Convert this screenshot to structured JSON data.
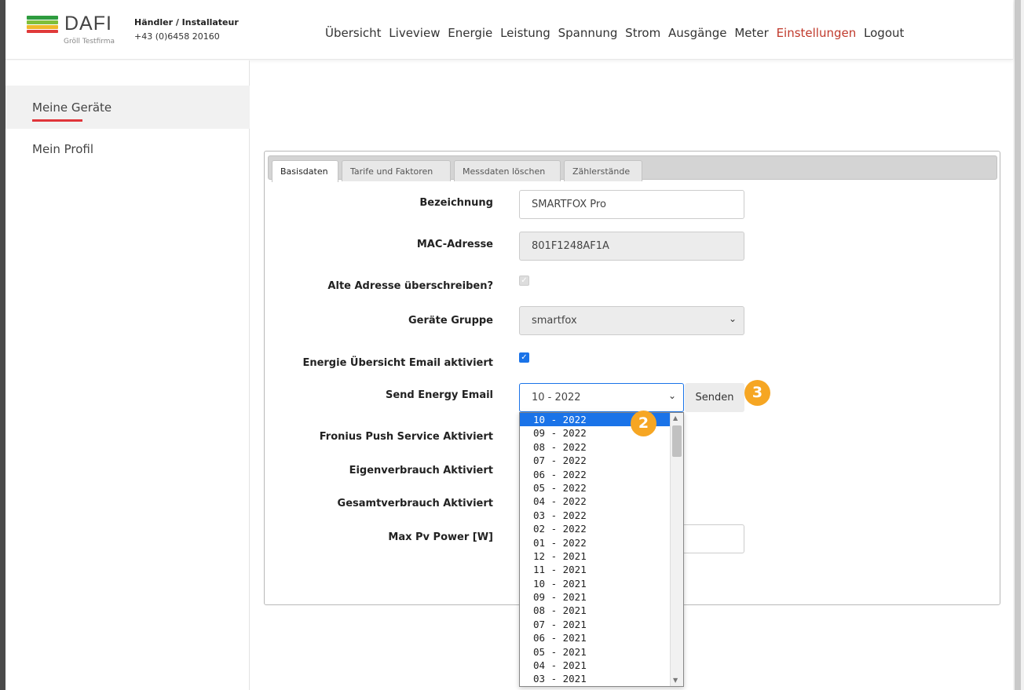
{
  "brand": {
    "name": "DAFI",
    "subtitle": "Gröll Testfirma",
    "logo_colors": [
      "#2e9c3f",
      "#7fbf3a",
      "#f0b92a",
      "#e03a3a"
    ]
  },
  "dealer": {
    "title": "Händler / Installateur",
    "phone": "+43 (0)6458 20160"
  },
  "nav": [
    "Übersicht",
    "Liveview",
    "Energie",
    "Leistung",
    "Spannung",
    "Strom",
    "Ausgänge",
    "Meter",
    "Einstellungen",
    "Logout"
  ],
  "nav_active": "Einstellungen",
  "sidebar": {
    "items": [
      {
        "label": "Meine Geräte",
        "active": true
      },
      {
        "label": "Mein Profil",
        "active": false
      }
    ]
  },
  "tabs": [
    {
      "label": "Basisdaten",
      "active": true
    },
    {
      "label": "Tarife und Faktoren",
      "active": false
    },
    {
      "label": "Messdaten löschen",
      "active": false
    },
    {
      "label": "Zählerstände",
      "active": false
    }
  ],
  "form": {
    "bezeichnung": {
      "label": "Bezeichnung",
      "value": "SMARTFOX Pro"
    },
    "mac": {
      "label": "MAC-Adresse",
      "value": "801F1248AF1A"
    },
    "alte_adresse": {
      "label": "Alte Adresse überschreiben?",
      "checked": true,
      "disabled": true
    },
    "gruppe": {
      "label": "Geräte Gruppe",
      "value": "smartfox"
    },
    "energie_email": {
      "label": "Energie Übersicht Email aktiviert",
      "checked": true
    },
    "send_energy": {
      "label": "Send Energy Email",
      "value": "10 - 2022",
      "button": "Senden"
    },
    "fronius": {
      "label": "Fronius Push Service Aktiviert"
    },
    "eigenverbrauch": {
      "label": "Eigenverbrauch Aktiviert"
    },
    "gesamtverbrauch": {
      "label": "Gesamtverbrauch Aktiviert"
    },
    "max_pv": {
      "label": "Max Pv Power [W]"
    }
  },
  "dropdown_options": [
    "10 - 2022",
    "09 - 2022",
    "08 - 2022",
    "07 - 2022",
    "06 - 2022",
    "05 - 2022",
    "04 - 2022",
    "03 - 2022",
    "02 - 2022",
    "01 - 2022",
    "12 - 2021",
    "11 - 2021",
    "10 - 2021",
    "09 - 2021",
    "08 - 2021",
    "07 - 2021",
    "06 - 2021",
    "05 - 2021",
    "04 - 2021",
    "03 - 2021"
  ],
  "dropdown_selected": "10 - 2022",
  "annotations": {
    "step_dropdown": "2",
    "step_send": "3",
    "badge_color": "#f6a623"
  },
  "colors": {
    "accent_red": "#c0392b",
    "sidebar_underline": "#e0353a",
    "select_blue": "#1a73e8"
  }
}
